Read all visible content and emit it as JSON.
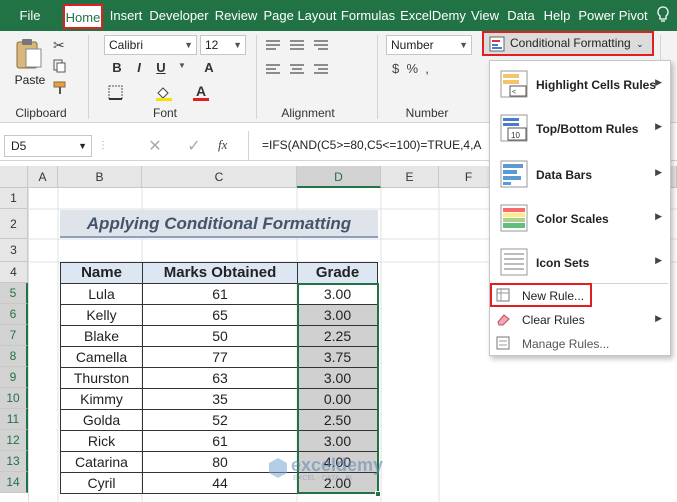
{
  "tabs": [
    "File",
    "Home",
    "Insert",
    "Developer",
    "Review",
    "Page Layout",
    "Formulas",
    "ExcelDemy",
    "View",
    "Data",
    "Help",
    "Power Pivot"
  ],
  "clipboard": {
    "paste_label": "Paste",
    "group_label": "Clipboard"
  },
  "font": {
    "name": "Calibri",
    "size": "12",
    "bold": "B",
    "italic": "I",
    "underline": "U",
    "font_color_letter": "A",
    "grow": "A",
    "group_label": "Font"
  },
  "alignment": {
    "group_label": "Alignment"
  },
  "number": {
    "format": "Number",
    "group_label": "Number"
  },
  "cf_button": {
    "label": "Conditional Formatting"
  },
  "formula_bar": {
    "name_box": "D5",
    "fx": "fx",
    "formula": "=IFS(AND(C5>=80,C5<=100)=TRUE,4,A"
  },
  "columns": [
    "A",
    "B",
    "C",
    "D",
    "E",
    "F"
  ],
  "rows": [
    "1",
    "2",
    "3",
    "4",
    "5",
    "6",
    "7",
    "8",
    "9",
    "10",
    "11",
    "12",
    "13",
    "14"
  ],
  "title": "Applying Conditional Formatting",
  "table": {
    "headers": [
      "Name",
      "Marks Obtained",
      "Grade"
    ],
    "rows": [
      [
        "Lula",
        "61",
        "3.00"
      ],
      [
        "Kelly",
        "65",
        "3.00"
      ],
      [
        "Blake",
        "50",
        "2.25"
      ],
      [
        "Camella",
        "77",
        "3.75"
      ],
      [
        "Thurston",
        "63",
        "3.00"
      ],
      [
        "Kimmy",
        "35",
        "0.00"
      ],
      [
        "Golda",
        "52",
        "2.50"
      ],
      [
        "Rick",
        "61",
        "3.00"
      ],
      [
        "Catarina",
        "80",
        "4.00"
      ],
      [
        "Cyril",
        "44",
        "2.00"
      ]
    ]
  },
  "cf_menu": {
    "items": [
      "Highlight Cells Rules",
      "Top/Bottom Rules",
      "Data Bars",
      "Color Scales",
      "Icon Sets"
    ],
    "new_rule": "New Rule...",
    "clear_rules": "Clear Rules",
    "manage_rules": "Manage Rules..."
  },
  "watermark": {
    "name": "exceldemy",
    "tag": "EXCEL · DATA · BI"
  },
  "colors": {
    "excel_green": "#217346",
    "highlight_red": "#e02020",
    "title_fill": "#dfe3ea",
    "title_text": "#44546a",
    "selected_fill": "#d0d0d0"
  }
}
